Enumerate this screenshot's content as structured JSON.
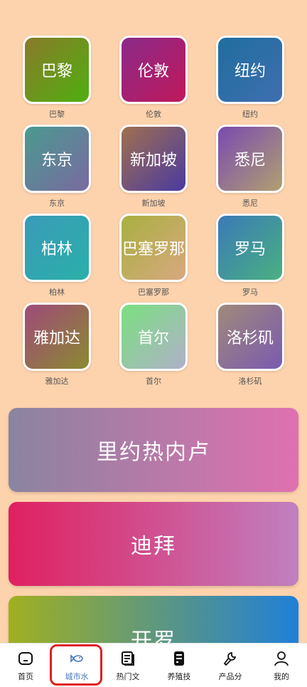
{
  "colors": {
    "background": "#fdd3ad",
    "accent": "#4a78c2",
    "highlight": "#e02020"
  },
  "cities": [
    {
      "tile": "巴黎",
      "caption": "巴黎"
    },
    {
      "tile": "伦敦",
      "caption": "伦敦"
    },
    {
      "tile": "纽约",
      "caption": "纽约"
    },
    {
      "tile": "东京",
      "caption": "东京"
    },
    {
      "tile": "新加坡",
      "caption": "新加坡"
    },
    {
      "tile": "悉尼",
      "caption": "悉尼"
    },
    {
      "tile": "柏林",
      "caption": "柏林"
    },
    {
      "tile": "巴塞罗那",
      "caption": "巴塞罗那"
    },
    {
      "tile": "罗马",
      "caption": "罗马"
    },
    {
      "tile": "雅加达",
      "caption": "雅加达"
    },
    {
      "tile": "首尔",
      "caption": "首尔"
    },
    {
      "tile": "洛杉矶",
      "caption": "洛杉矶"
    }
  ],
  "banners": [
    {
      "label": "里约热内卢"
    },
    {
      "label": "迪拜"
    },
    {
      "label": "开罗"
    }
  ],
  "nav": [
    {
      "label": "首页",
      "icon": "home-icon"
    },
    {
      "label": "城市水",
      "icon": "fish-icon"
    },
    {
      "label": "热门文",
      "icon": "article-icon"
    },
    {
      "label": "养殖技",
      "icon": "device-icon"
    },
    {
      "label": "产品分",
      "icon": "wrench-icon"
    },
    {
      "label": "我的",
      "icon": "user-icon"
    }
  ]
}
